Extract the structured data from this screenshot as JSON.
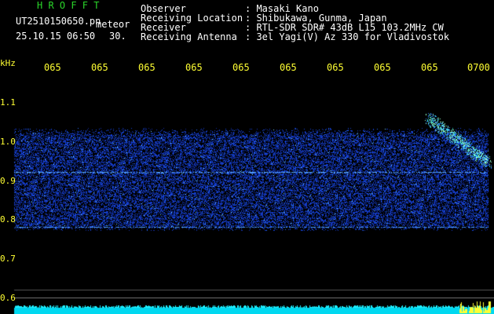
{
  "header": {
    "app_title": "H R O F F T",
    "filename": "UT2510150650.pn",
    "mode": "meteor",
    "datetime": "25.10.15 06:50",
    "seconds": "30.",
    "info_labels": [
      "Observer",
      "Receiving Location",
      "Receiver",
      "Receiving Antenna"
    ],
    "info_values": [
      ": Masaki Kano",
      ": Shibukawa, Gunma, Japan",
      ": RTL-SDR SDR# 43dB L15 103.2MHz CW",
      ": 3el Yagi(V) Az 330 for Vladivostok"
    ]
  },
  "axis": {
    "y_unit": "kHz",
    "y_ticks": [
      "1.1",
      "1.0",
      "0.9",
      "0.8",
      "0.7",
      "0.6"
    ],
    "x_ticks": [
      "065",
      "065",
      "065",
      "065",
      "065",
      "065",
      "065",
      "065",
      "065",
      "0700"
    ]
  },
  "colors": {
    "background": "#000000",
    "axis_text": "#ffff33",
    "title_green": "#2ad62a",
    "noise_blue": "#1a3cff",
    "echo_cyan": "#66ffee",
    "bottom_bar": "#00e5ff"
  }
}
